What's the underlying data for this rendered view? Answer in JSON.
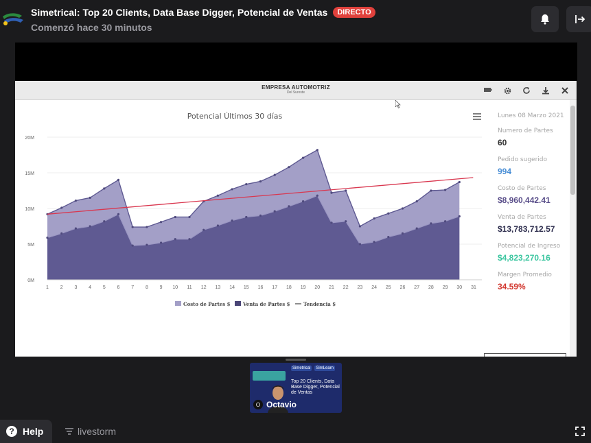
{
  "header": {
    "title": "Simetrical: Top 20 Clients, Data Base Digger, Potencial de Ventas",
    "live_badge": "DIRECTO",
    "subtitle": "Comenzó hace 30 minutos",
    "notification_icon": "bell-icon",
    "leave_icon": "exit-icon"
  },
  "shared_screen": {
    "company": "EMPRESA AUTOMOTRIZ",
    "company_sub": "Del Sureste",
    "tools": [
      "presentation-icon",
      "gear-icon",
      "refresh-icon",
      "download-icon",
      "close-icon"
    ],
    "stats": [
      {
        "label": "Lunes 08 Marzo 2021",
        "value": "",
        "color": "#888888"
      },
      {
        "label": "Numero de Partes",
        "value": "60",
        "color": "#333333"
      },
      {
        "label": "Pedido sugerido",
        "value": "994",
        "color": "#4a8fd6"
      },
      {
        "label": "Costo de Partes",
        "value": "$8,960,442.41",
        "color": "#5a4f8a"
      },
      {
        "label": "Venta de Partes",
        "value": "$13,783,712.57",
        "color": "#2f2f4f"
      },
      {
        "label": "Potencial de Ingreso",
        "value": "$4,823,270.16",
        "color": "#3cc6a0"
      },
      {
        "label": "Margen Promedio",
        "value": "34.59%",
        "color": "#d2382f"
      }
    ]
  },
  "chart_data": {
    "type": "area",
    "title": "Potencial Últimos 30 días",
    "x": [
      1,
      2,
      3,
      4,
      5,
      6,
      7,
      8,
      9,
      10,
      11,
      12,
      13,
      14,
      15,
      16,
      17,
      18,
      19,
      20,
      21,
      22,
      23,
      24,
      25,
      26,
      27,
      28,
      29,
      30
    ],
    "x_ticks": [
      "1",
      "2",
      "3",
      "4",
      "5",
      "6",
      "7",
      "8",
      "9",
      "10",
      "11",
      "12",
      "13",
      "14",
      "15",
      "16",
      "17",
      "18",
      "19",
      "20",
      "21",
      "22",
      "23",
      "24",
      "25",
      "26",
      "27",
      "28",
      "29",
      "30",
      "31"
    ],
    "y_ticks": [
      "0M",
      "5M",
      "10M",
      "15M",
      "20M"
    ],
    "ylim": [
      0,
      20
    ],
    "series": [
      {
        "name": "Costo de Partes $",
        "color": "#5f5a92",
        "values": [
          5.9,
          6.5,
          7.2,
          7.5,
          8.2,
          9.2,
          4.8,
          4.9,
          5.2,
          5.7,
          5.7,
          7.0,
          7.6,
          8.3,
          8.8,
          9.0,
          9.6,
          10.3,
          11.0,
          11.8,
          8.0,
          8.2,
          5.0,
          5.3,
          6.0,
          6.5,
          7.2,
          7.9,
          8.2,
          8.9
        ],
        "line_color": "#9a96c2",
        "marker_color": "#4f4a7d"
      },
      {
        "name": "Venta de Partes $",
        "color": "#a39fc7",
        "values": [
          9.2,
          10.1,
          11.1,
          11.5,
          12.8,
          14.0,
          7.4,
          7.4,
          8.1,
          8.8,
          8.8,
          11.0,
          11.8,
          12.7,
          13.4,
          13.8,
          14.7,
          15.8,
          17.1,
          18.2,
          12.2,
          12.5,
          7.5,
          8.6,
          9.3,
          10.0,
          11.0,
          12.5,
          12.6,
          13.7
        ],
        "line_color": "#5f5a92",
        "marker_color": "#4f4a7d"
      },
      {
        "name": "Tendencia $",
        "color": "#d9374f",
        "values": [
          9.2,
          9.37,
          9.54,
          9.71,
          9.88,
          10.05,
          10.22,
          10.39,
          10.56,
          10.73,
          10.9,
          11.07,
          11.24,
          11.41,
          11.58,
          11.75,
          11.92,
          12.09,
          12.26,
          12.43,
          12.6,
          12.77,
          12.94,
          13.11,
          13.28,
          13.45,
          13.62,
          13.79,
          13.96,
          14.13
        ]
      }
    ],
    "legend": "bottom-center",
    "grid": true
  },
  "presenter": {
    "name": "Octavio",
    "avatar_initial": "O",
    "slide_text": "Top 20 Clients, Data Base Digger, Potencial de Ventas",
    "slide_brand_1": "Simetrical",
    "slide_brand_2": "SimLearn"
  },
  "footer": {
    "help_label": "Help",
    "powered_by": "livestorm",
    "fullscreen_icon": "fullscreen-icon"
  }
}
